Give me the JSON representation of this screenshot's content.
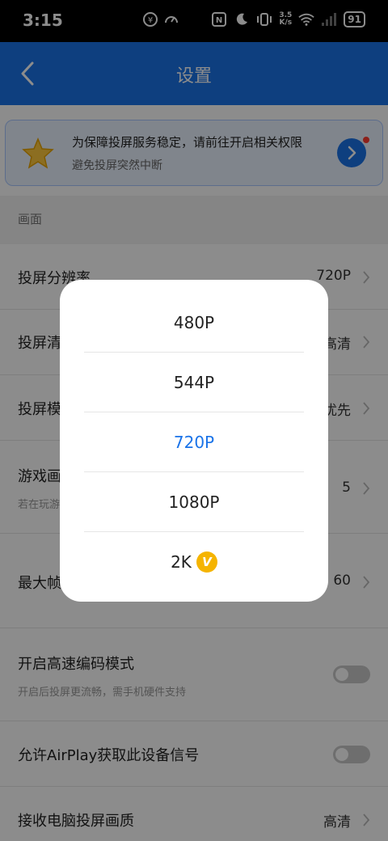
{
  "status_bar": {
    "time": "3:15",
    "speed_value": "3.5",
    "speed_unit": "K/s",
    "battery": "91"
  },
  "app_bar": {
    "title": "设置"
  },
  "banner": {
    "title": "为保障投屏服务稳定，请前往开启相关权限",
    "subtitle": "避免投屏突然中断"
  },
  "section": {
    "label": "画面"
  },
  "rows": [
    {
      "label": "投屏分辨率",
      "value": "720P"
    },
    {
      "label": "投屏清晰度",
      "value": "高清"
    },
    {
      "label": "投屏模式",
      "value": "流畅优先"
    },
    {
      "label": "游戏画面",
      "sub": "若在玩游戏时开启",
      "value": "5"
    },
    {
      "label": "最大帧率",
      "value": "60"
    },
    {
      "label": "开启高速编码模式",
      "sub": "开启后投屏更流畅，需手机硬件支持",
      "toggle": false
    },
    {
      "label": "允许AirPlay获取此设备信号",
      "toggle": false
    },
    {
      "label": "接收电脑投屏画质",
      "value": "高清"
    }
  ],
  "picker": {
    "options": [
      "480P",
      "544P",
      "720P",
      "1080P",
      "2K"
    ],
    "selected": "720P",
    "vip_badge": "V"
  },
  "colors": {
    "accent": "#1a73e8",
    "vip": "#f5b400"
  }
}
